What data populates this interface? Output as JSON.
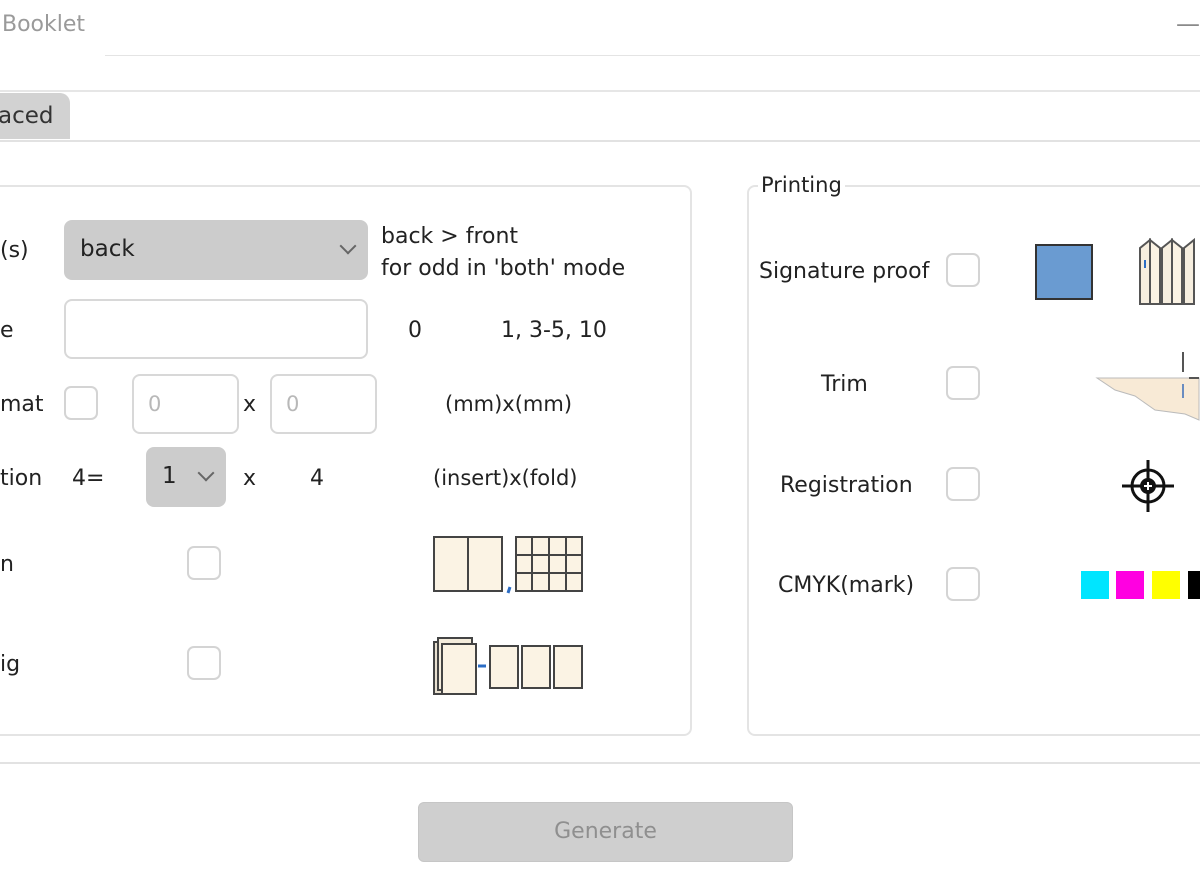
{
  "window": {
    "title": "Booklet",
    "minimize_glyph": "—"
  },
  "tabs": [
    {
      "label": "aced"
    }
  ],
  "left_group": {
    "rows": {
      "side": {
        "label": "(s)",
        "value": "back",
        "hint_line1": "back > front",
        "hint_line2": "for odd in 'both' mode"
      },
      "range": {
        "label": "e",
        "value": "",
        "count": "0",
        "example": "1, 3-5, 10"
      },
      "format": {
        "label": "mat",
        "width_placeholder": "0",
        "separator": "x",
        "height_placeholder": "0",
        "unit": "(mm)x(mm)"
      },
      "imposition": {
        "label": "tion",
        "prefix": "4=",
        "insert_value": "1",
        "separator": "x",
        "fold_value": "4",
        "unit": "(insert)x(fold)"
      },
      "row5": {
        "label": "n",
        "icon": "page-layout-icon"
      },
      "row6": {
        "label": "ig",
        "icon": "stack-to-pages-icon"
      }
    }
  },
  "printing": {
    "legend": "Printing",
    "signature_proof": {
      "label": "Signature proof",
      "swatch_color": "#6a9bd1",
      "icon": "folded-signatures-icon"
    },
    "trim": {
      "label": "Trim",
      "icon": "trim-mark-icon"
    },
    "registration": {
      "label": "Registration",
      "icon": "crosshair-icon"
    },
    "cmyk": {
      "label": "CMYK(mark)",
      "colors": [
        "#00e5ff",
        "#ff00e1",
        "#ffff00",
        "#000000"
      ]
    }
  },
  "footer": {
    "generate_label": "Generate"
  }
}
